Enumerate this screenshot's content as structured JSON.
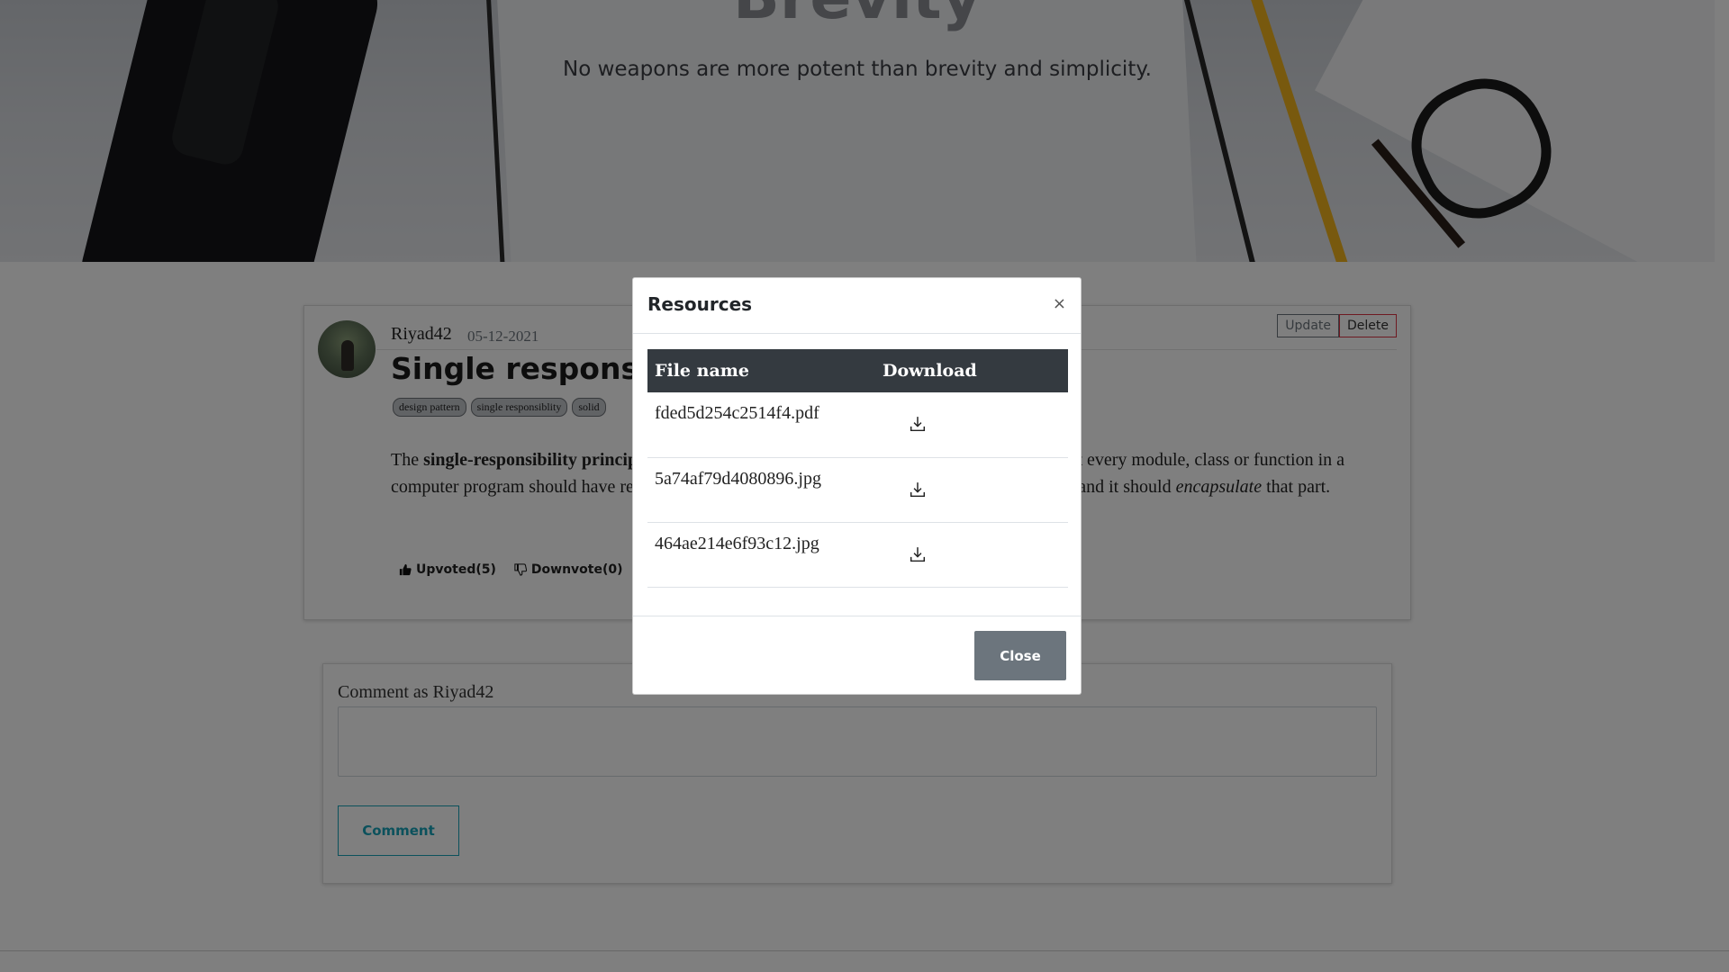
{
  "hero": {
    "title": "Brevity",
    "subtitle": "No weapons are more potent than brevity and simplicity."
  },
  "post": {
    "author": "Riyad42",
    "date": "05-12-2021",
    "title": "Single responsibility principle",
    "tags": [
      "design pattern",
      "single responsiblity",
      "solid"
    ],
    "body": {
      "intro": "The ",
      "term": "single-responsibility principle (SRP)",
      "mid": " is a computer-programming principle that states that every module, class or function in a computer program should have responsibility over a single part of that program's functionality, and it should ",
      "emph": "encapsulate",
      "end": " that part."
    },
    "upvote_label": "Upvoted(5)",
    "downvote_label": "Downvote(0)",
    "update_label": "Update",
    "delete_label": "Delete"
  },
  "comment": {
    "label": "Comment as Riyad42",
    "placeholder": "",
    "button_label": "Comment"
  },
  "modal": {
    "title": "Resources",
    "close_x": "×",
    "columns": [
      "File name",
      "Download"
    ],
    "files": [
      {
        "name": "fded5d254c2514f4.pdf",
        "icon": "download-icon"
      },
      {
        "name": "5a74af79d4080896.jpg",
        "icon": "download-icon"
      },
      {
        "name": "464ae214e6f93c12.jpg",
        "icon": "download-icon"
      }
    ],
    "close_label": "Close"
  },
  "colors": {
    "overlay": "rgba(0,0,0,0.5)",
    "table_header": "#343a40",
    "close_button": "#6c757d",
    "comment_button": "#17a2b8",
    "delete_border": "#dc3545"
  }
}
